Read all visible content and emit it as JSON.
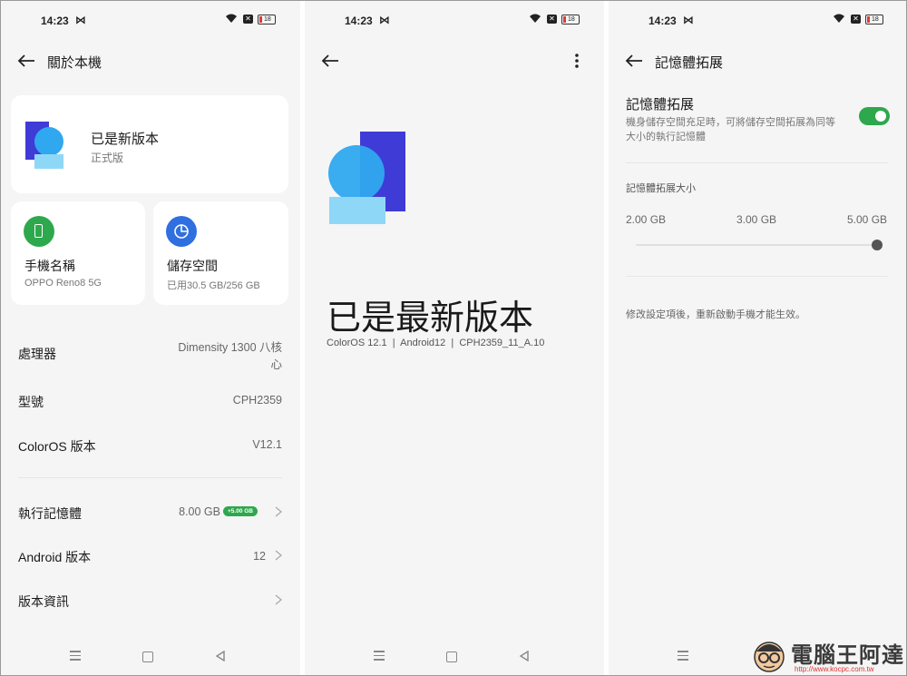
{
  "status": {
    "time": "14:23",
    "battery": "18"
  },
  "screen1": {
    "title": "關於本機",
    "version_card": {
      "title": "已是新版本",
      "subtitle": "正式版"
    },
    "phone_name_card": {
      "label": "手機名稱",
      "value": "OPPO Reno8 5G"
    },
    "storage_card": {
      "label": "儲存空間",
      "value": "已用30.5 GB/256 GB"
    },
    "rows": [
      {
        "label": "處理器",
        "value_line1": "Dimensity 1300 八核",
        "value_line2": "心"
      },
      {
        "label": "型號",
        "value": "CPH2359"
      },
      {
        "label": "ColorOS 版本",
        "value": "V12.1"
      },
      {
        "label": "執行記憶體",
        "value": "8.00 GB",
        "badge": "+5.00 GB"
      },
      {
        "label": "Android 版本",
        "value": "12"
      },
      {
        "label": "版本資訊",
        "value": ""
      }
    ]
  },
  "screen2": {
    "headline": "已是最新版本",
    "version_line": "ColorOS 12.1  |  Android12  |  CPH2359_11_A.10"
  },
  "screen3": {
    "title": "記憶體拓展",
    "toggle_title": "記憶體拓展",
    "toggle_desc_line1": "機身儲存空間充足時，可將儲存空間拓展為同等",
    "toggle_desc_line2": "大小的執行記憶體",
    "toggle_on": true,
    "size_heading": "記憶體拓展大小",
    "options": [
      "2.00 GB",
      "3.00 GB",
      "5.00 GB"
    ],
    "selected_option": "5.00 GB",
    "note": "修改設定項後，重新啟動手機才能生效。"
  },
  "watermark": {
    "text": "電腦王阿達",
    "url": "http://www.kocpc.com.tw"
  },
  "colors": {
    "accent_green": "#2ea84d",
    "icon_blue": "#2f6fe0",
    "logo_indigo": "#3f3bd6",
    "logo_cyan": "#2fa8ef"
  },
  "icons": [
    "arrow-left-icon",
    "more-vert-icon",
    "phone-icon",
    "pie-chart-icon",
    "chevron-right-icon",
    "wifi-icon",
    "battery-icon"
  ]
}
